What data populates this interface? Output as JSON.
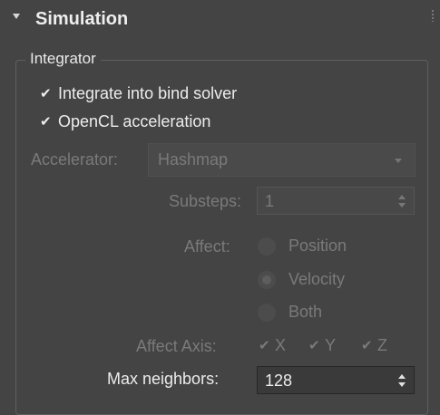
{
  "rollout": {
    "title": "Simulation"
  },
  "group": {
    "label": "Integrator"
  },
  "checkboxes": {
    "integrate": {
      "label": "Integrate into bind solver",
      "checked": true
    },
    "opencl": {
      "label": "OpenCL acceleration",
      "checked": true
    }
  },
  "accelerator": {
    "label": "Accelerator:",
    "value": "Hashmap"
  },
  "substeps": {
    "label": "Substeps:",
    "value": "1"
  },
  "affect": {
    "label": "Affect:",
    "options": [
      "Position",
      "Velocity",
      "Both"
    ],
    "selected": "Velocity"
  },
  "affect_axis": {
    "label": "Affect Axis:",
    "x": "X",
    "y": "Y",
    "z": "Z"
  },
  "max_neighbors": {
    "label": "Max neighbors:",
    "value": "128"
  },
  "icons": {
    "check": "✔"
  },
  "colors": {
    "background": "#444444",
    "disabled_text": "#7a7a7a",
    "enabled_text": "#ececec"
  }
}
